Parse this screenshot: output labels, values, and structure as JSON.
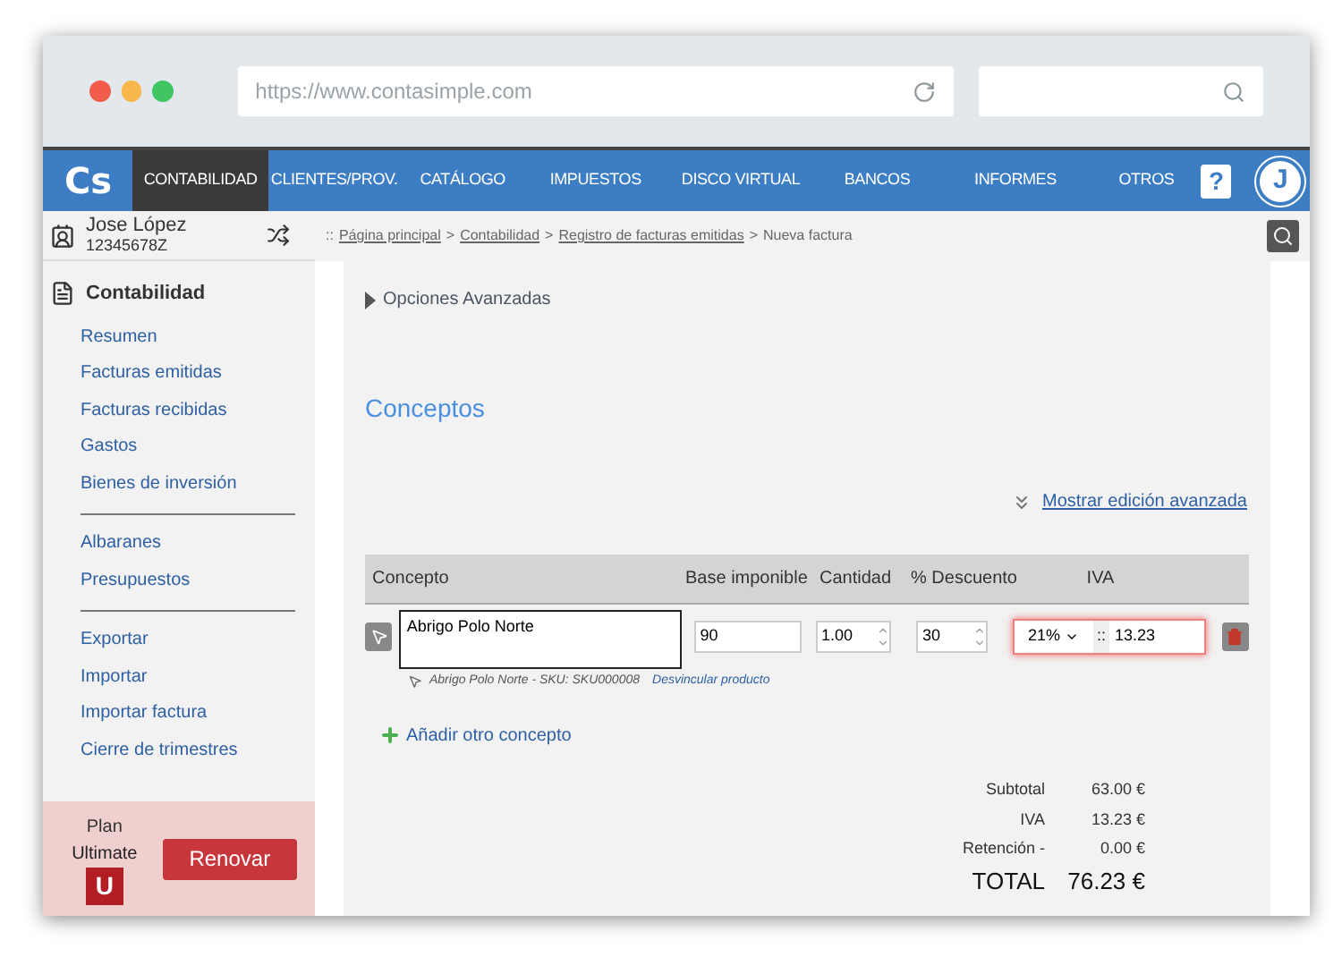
{
  "browser": {
    "url": "https://www.contasimple.com"
  },
  "nav": {
    "logo": "Cs",
    "items": [
      {
        "label": "CONTABILIDAD",
        "selected": true
      },
      {
        "label": "CLIENTES/PROV.",
        "selected": false
      },
      {
        "label": "CATÁLOGO",
        "selected": false
      },
      {
        "label": "IMPUESTOS",
        "selected": false
      },
      {
        "label": "DISCO VIRTUAL",
        "selected": false
      },
      {
        "label": "BANCOS",
        "selected": false
      },
      {
        "label": "INFORMES",
        "selected": false
      },
      {
        "label": "OTROS",
        "selected": false
      }
    ],
    "help": "?",
    "avatar": "J"
  },
  "user": {
    "name": "Jose López",
    "id": "12345678Z"
  },
  "breadcrumb": {
    "prefix": "::",
    "separator": ">",
    "items": [
      {
        "label": "Página principal",
        "kind": "link"
      },
      {
        "label": "Contabilidad",
        "kind": "link"
      },
      {
        "label": "Registro de facturas emitidas",
        "kind": "link"
      },
      {
        "label": "Nueva factura",
        "kind": "current"
      }
    ]
  },
  "sidebar": {
    "section": "Contabilidad",
    "groups": [
      [
        "Resumen",
        "Facturas emitidas",
        "Facturas recibidas",
        "Gastos",
        "Bienes de inversión"
      ],
      [
        "Albaranes",
        "Presupuestos"
      ],
      [
        "Exportar",
        "Importar",
        "Importar factura",
        "Cierre de trimestres"
      ]
    ]
  },
  "plan": {
    "label": "Plan",
    "name": "Ultimate",
    "badge": "U",
    "button": "Renovar"
  },
  "main": {
    "advanced_options": "Opciones Avanzadas",
    "heading": "Conceptos",
    "advanced_link": "Mostrar edición avanzada",
    "columns": [
      "Concepto",
      "Base imponible",
      "Cantidad",
      "% Descuento",
      "IVA"
    ],
    "row": {
      "concept": "Abrigo Polo Norte",
      "base": "90",
      "quantity": "1.00",
      "discount": "30",
      "vat_rate": "21%",
      "vat_separator": "::",
      "vat_amount": "13.23",
      "vat_error": true,
      "product_info": "Abrigo Polo Norte - SKU: SKU000008",
      "unlink": "Desvincular producto"
    },
    "add": "Añadir otro concepto",
    "totals": [
      {
        "label": "Subtotal",
        "value": "63.00 €"
      },
      {
        "label": "IVA",
        "value": "13.23 €"
      },
      {
        "label": "Retención -",
        "value": "0.00 €"
      }
    ],
    "total": {
      "label": "TOTAL",
      "value": "76.23 €"
    }
  }
}
